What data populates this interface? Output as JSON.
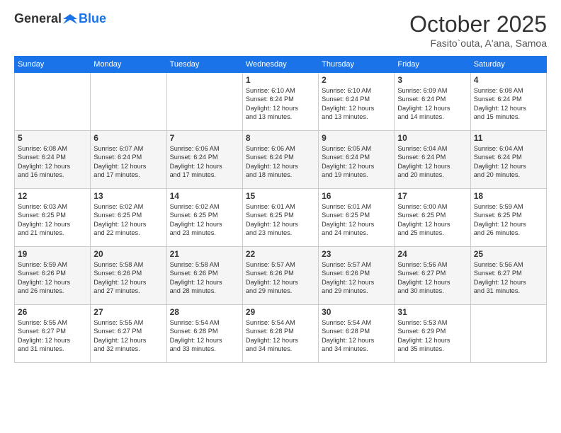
{
  "header": {
    "logo_general": "General",
    "logo_blue": "Blue",
    "month_title": "October 2025",
    "location": "Fasito`outa, A'ana, Samoa"
  },
  "days_of_week": [
    "Sunday",
    "Monday",
    "Tuesday",
    "Wednesday",
    "Thursday",
    "Friday",
    "Saturday"
  ],
  "weeks": [
    [
      {
        "num": "",
        "text": ""
      },
      {
        "num": "",
        "text": ""
      },
      {
        "num": "",
        "text": ""
      },
      {
        "num": "1",
        "text": "Sunrise: 6:10 AM\nSunset: 6:24 PM\nDaylight: 12 hours\nand 13 minutes."
      },
      {
        "num": "2",
        "text": "Sunrise: 6:10 AM\nSunset: 6:24 PM\nDaylight: 12 hours\nand 13 minutes."
      },
      {
        "num": "3",
        "text": "Sunrise: 6:09 AM\nSunset: 6:24 PM\nDaylight: 12 hours\nand 14 minutes."
      },
      {
        "num": "4",
        "text": "Sunrise: 6:08 AM\nSunset: 6:24 PM\nDaylight: 12 hours\nand 15 minutes."
      }
    ],
    [
      {
        "num": "5",
        "text": "Sunrise: 6:08 AM\nSunset: 6:24 PM\nDaylight: 12 hours\nand 16 minutes."
      },
      {
        "num": "6",
        "text": "Sunrise: 6:07 AM\nSunset: 6:24 PM\nDaylight: 12 hours\nand 17 minutes."
      },
      {
        "num": "7",
        "text": "Sunrise: 6:06 AM\nSunset: 6:24 PM\nDaylight: 12 hours\nand 17 minutes."
      },
      {
        "num": "8",
        "text": "Sunrise: 6:06 AM\nSunset: 6:24 PM\nDaylight: 12 hours\nand 18 minutes."
      },
      {
        "num": "9",
        "text": "Sunrise: 6:05 AM\nSunset: 6:24 PM\nDaylight: 12 hours\nand 19 minutes."
      },
      {
        "num": "10",
        "text": "Sunrise: 6:04 AM\nSunset: 6:24 PM\nDaylight: 12 hours\nand 20 minutes."
      },
      {
        "num": "11",
        "text": "Sunrise: 6:04 AM\nSunset: 6:24 PM\nDaylight: 12 hours\nand 20 minutes."
      }
    ],
    [
      {
        "num": "12",
        "text": "Sunrise: 6:03 AM\nSunset: 6:25 PM\nDaylight: 12 hours\nand 21 minutes."
      },
      {
        "num": "13",
        "text": "Sunrise: 6:02 AM\nSunset: 6:25 PM\nDaylight: 12 hours\nand 22 minutes."
      },
      {
        "num": "14",
        "text": "Sunrise: 6:02 AM\nSunset: 6:25 PM\nDaylight: 12 hours\nand 23 minutes."
      },
      {
        "num": "15",
        "text": "Sunrise: 6:01 AM\nSunset: 6:25 PM\nDaylight: 12 hours\nand 23 minutes."
      },
      {
        "num": "16",
        "text": "Sunrise: 6:01 AM\nSunset: 6:25 PM\nDaylight: 12 hours\nand 24 minutes."
      },
      {
        "num": "17",
        "text": "Sunrise: 6:00 AM\nSunset: 6:25 PM\nDaylight: 12 hours\nand 25 minutes."
      },
      {
        "num": "18",
        "text": "Sunrise: 5:59 AM\nSunset: 6:25 PM\nDaylight: 12 hours\nand 26 minutes."
      }
    ],
    [
      {
        "num": "19",
        "text": "Sunrise: 5:59 AM\nSunset: 6:26 PM\nDaylight: 12 hours\nand 26 minutes."
      },
      {
        "num": "20",
        "text": "Sunrise: 5:58 AM\nSunset: 6:26 PM\nDaylight: 12 hours\nand 27 minutes."
      },
      {
        "num": "21",
        "text": "Sunrise: 5:58 AM\nSunset: 6:26 PM\nDaylight: 12 hours\nand 28 minutes."
      },
      {
        "num": "22",
        "text": "Sunrise: 5:57 AM\nSunset: 6:26 PM\nDaylight: 12 hours\nand 29 minutes."
      },
      {
        "num": "23",
        "text": "Sunrise: 5:57 AM\nSunset: 6:26 PM\nDaylight: 12 hours\nand 29 minutes."
      },
      {
        "num": "24",
        "text": "Sunrise: 5:56 AM\nSunset: 6:27 PM\nDaylight: 12 hours\nand 30 minutes."
      },
      {
        "num": "25",
        "text": "Sunrise: 5:56 AM\nSunset: 6:27 PM\nDaylight: 12 hours\nand 31 minutes."
      }
    ],
    [
      {
        "num": "26",
        "text": "Sunrise: 5:55 AM\nSunset: 6:27 PM\nDaylight: 12 hours\nand 31 minutes."
      },
      {
        "num": "27",
        "text": "Sunrise: 5:55 AM\nSunset: 6:27 PM\nDaylight: 12 hours\nand 32 minutes."
      },
      {
        "num": "28",
        "text": "Sunrise: 5:54 AM\nSunset: 6:28 PM\nDaylight: 12 hours\nand 33 minutes."
      },
      {
        "num": "29",
        "text": "Sunrise: 5:54 AM\nSunset: 6:28 PM\nDaylight: 12 hours\nand 34 minutes."
      },
      {
        "num": "30",
        "text": "Sunrise: 5:54 AM\nSunset: 6:28 PM\nDaylight: 12 hours\nand 34 minutes."
      },
      {
        "num": "31",
        "text": "Sunrise: 5:53 AM\nSunset: 6:29 PM\nDaylight: 12 hours\nand 35 minutes."
      },
      {
        "num": "",
        "text": ""
      }
    ]
  ]
}
